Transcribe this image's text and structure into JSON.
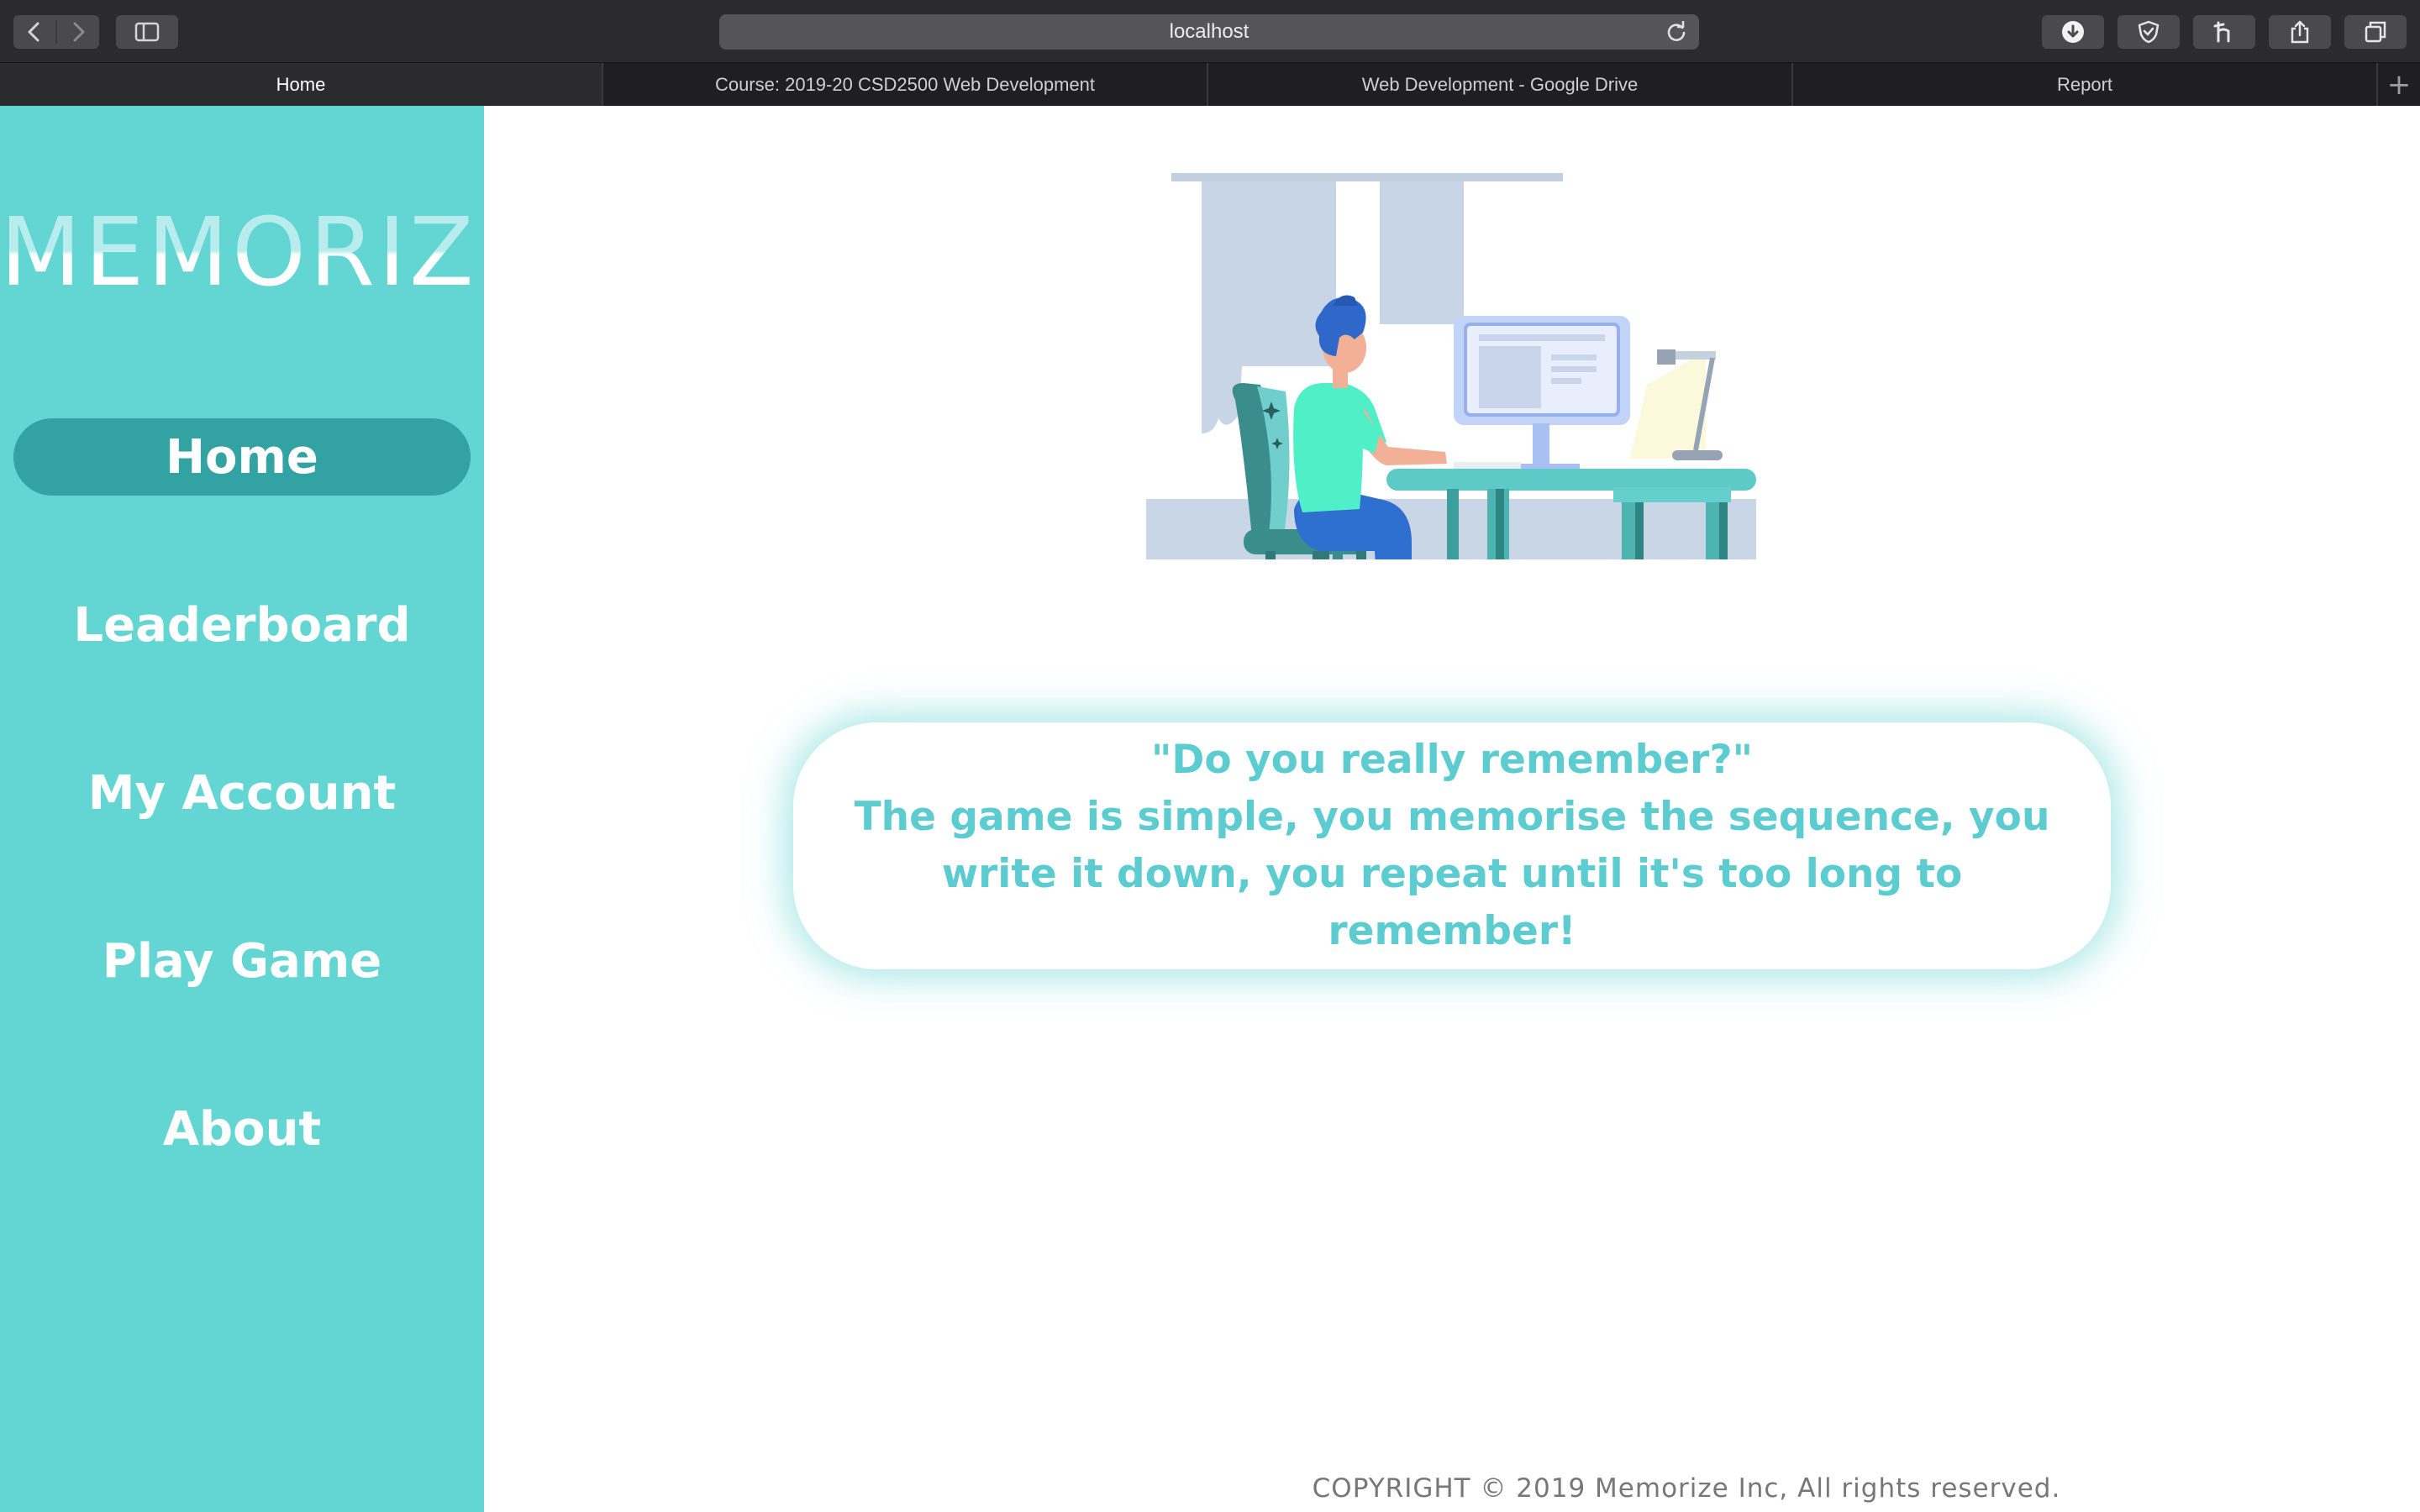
{
  "browser": {
    "url": "localhost",
    "tabs": [
      {
        "label": "Home",
        "active": true
      },
      {
        "label": "Course: 2019-20 CSD2500 Web Development",
        "active": false
      },
      {
        "label": "Web Development - Google Drive",
        "active": false
      },
      {
        "label": "Report",
        "active": false
      }
    ],
    "new_tab_label": "+",
    "icons": [
      "back-icon",
      "forward-icon",
      "sidebar-toggle-icon",
      "reload-icon",
      "download-icon",
      "shield-icon",
      "hook-icon",
      "share-icon",
      "tabs-overview-icon"
    ]
  },
  "sidebar": {
    "logo": "MEMORIZE",
    "items": [
      {
        "label": "Home",
        "active": true
      },
      {
        "label": "Leaderboard",
        "active": false
      },
      {
        "label": "My Account",
        "active": false
      },
      {
        "label": "Play Game",
        "active": false
      },
      {
        "label": "About",
        "active": false
      }
    ]
  },
  "main": {
    "quote_line": "\"Do you really remember?\"",
    "description": "The game is simple, you memorise the sequence, you write it down, you repeat until it's too long to remember!",
    "footer": "COPYRIGHT © 2019 Memorize Inc, All rights reserved."
  },
  "colors": {
    "sidebar_bg": "#63d5d3",
    "active_nav_bg": "#32a3a2",
    "accent_text": "#5cccd0",
    "chrome_bg": "#2b2a2c"
  }
}
